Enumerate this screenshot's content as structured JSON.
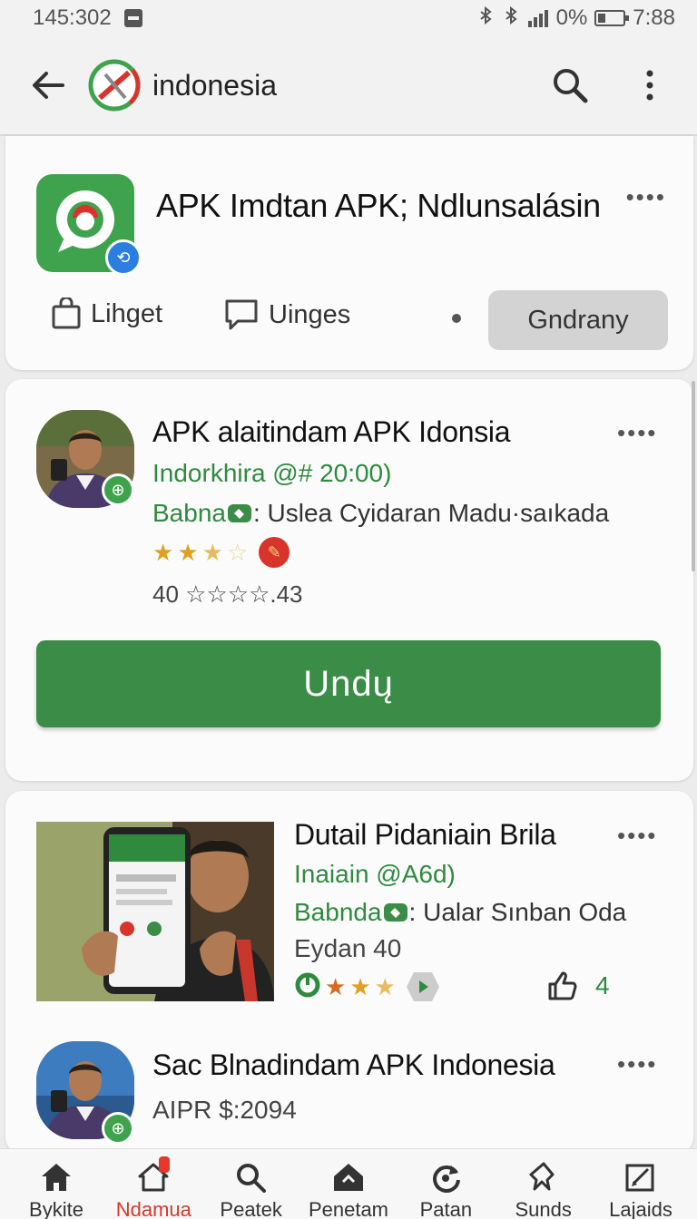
{
  "status_bar": {
    "time_left": "145:302",
    "battery": "0%",
    "clock": "7:88"
  },
  "app_bar": {
    "title": "indonesia"
  },
  "hero": {
    "title": "APK Imdtan APK; Ndlunsalásin",
    "more": "••••",
    "chip_a": "Lihget",
    "chip_b": "Uinges",
    "button": "Gndrany"
  },
  "item1": {
    "title": "APK alaitindam APK Idonsia",
    "subtitle": "Indorkhira @# 20:00)",
    "line_green": "Babna",
    "line_text": ": Uslea Cyidaran Madu·saıkada",
    "rating_text": "40 ☆☆☆☆.43",
    "rating": 2.5,
    "button": "Undų",
    "more": "••••"
  },
  "item2": {
    "title": "Dutail Pidaniain Brila",
    "subtitle": "Inaiain @A6d)",
    "line_green": "Babnda",
    "line_text": ": Ualar Sınban Oda",
    "meta": "Eydan 40",
    "like_count": "4",
    "rating": 2.5,
    "more": "••••"
  },
  "item3": {
    "title": "Sac Blnadindam APK Indonesia",
    "meta": "AIPR $:2094",
    "more": "••••"
  },
  "nav": [
    {
      "label": "Bykite",
      "icon": "home-icon"
    },
    {
      "label": "Ndamua",
      "icon": "notification-home-icon"
    },
    {
      "label": "Peatek",
      "icon": "search-icon"
    },
    {
      "label": "Penetam",
      "icon": "tag-icon"
    },
    {
      "label": "Patan",
      "icon": "refresh-icon"
    },
    {
      "label": "Sunds",
      "icon": "pin-icon"
    },
    {
      "label": "Lajaids",
      "icon": "edit-icon"
    }
  ],
  "colors": {
    "accent_green": "#3a8c47",
    "active_nav": "#d23a2a",
    "background": "#ececec"
  }
}
